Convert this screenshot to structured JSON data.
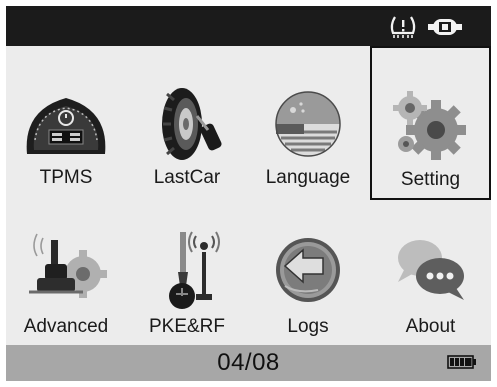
{
  "status_bar": {
    "tpms_indicator": "tpms-warning-icon",
    "power_indicator": "power-icon"
  },
  "menu": {
    "items": [
      {
        "label": "TPMS",
        "icon": "speedometer-tpms-icon"
      },
      {
        "label": "LastCar",
        "icon": "wheel-key-icon"
      },
      {
        "label": "Language",
        "icon": "flag-globe-icon"
      },
      {
        "label": "Setting",
        "icon": "gears-icon",
        "selected": true
      },
      {
        "label": "Advanced",
        "icon": "sensor-gear-icon"
      },
      {
        "label": "PKE&RF",
        "icon": "key-antenna-icon"
      },
      {
        "label": "Logs",
        "icon": "back-arrow-disc-icon"
      },
      {
        "label": "About",
        "icon": "chat-bubbles-icon"
      }
    ]
  },
  "footer": {
    "page": "04/08",
    "battery_icon": "battery-full-icon"
  },
  "colors": {
    "topbar": "#1b1b1b",
    "screen_bg": "#ececec",
    "footer_bg": "#a7a7a7",
    "selection_border": "#111111"
  }
}
